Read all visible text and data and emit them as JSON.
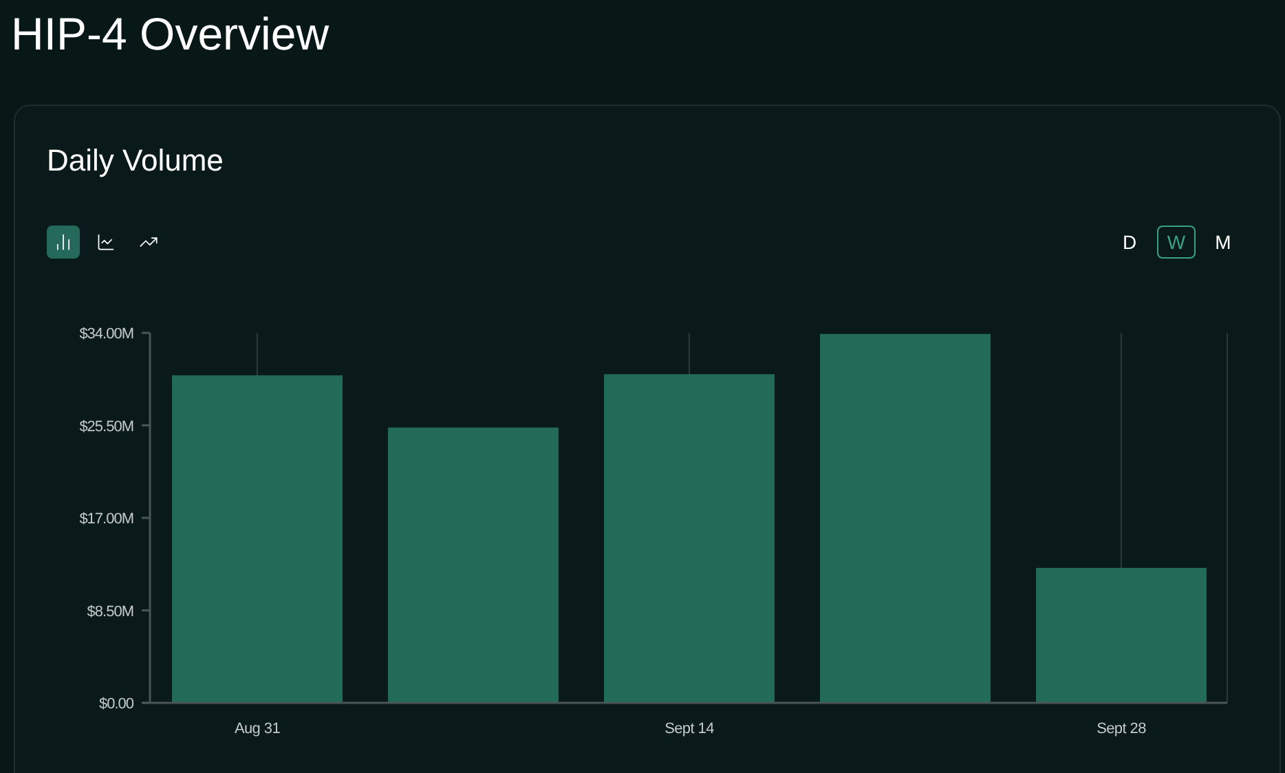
{
  "title": "HIP-4 Overview",
  "card": {
    "title": "Daily Volume",
    "chart_types": [
      {
        "kind": "bar",
        "selected": true
      },
      {
        "kind": "line",
        "selected": false
      },
      {
        "kind": "trend",
        "selected": false
      }
    ],
    "intervals": [
      {
        "label": "D",
        "selected": false
      },
      {
        "label": "W",
        "selected": true
      },
      {
        "label": "M",
        "selected": false
      }
    ],
    "chart_data": {
      "type": "bar",
      "categories": [
        "Aug 31",
        null,
        "Sept 14",
        null,
        "Sept 28"
      ],
      "values": [
        30.1,
        25.3,
        30.2,
        33.9,
        12.4
      ],
      "ylim": [
        0,
        34
      ],
      "grid": true,
      "yticks": [
        {
          "value": 0,
          "label": "$0.00"
        },
        {
          "value": 8.5,
          "label": "$8.50M"
        },
        {
          "value": 17,
          "label": "$17.00M"
        },
        {
          "value": 25.5,
          "label": "$25.50M"
        },
        {
          "value": 34,
          "label": "$34.00M"
        }
      ]
    }
  }
}
